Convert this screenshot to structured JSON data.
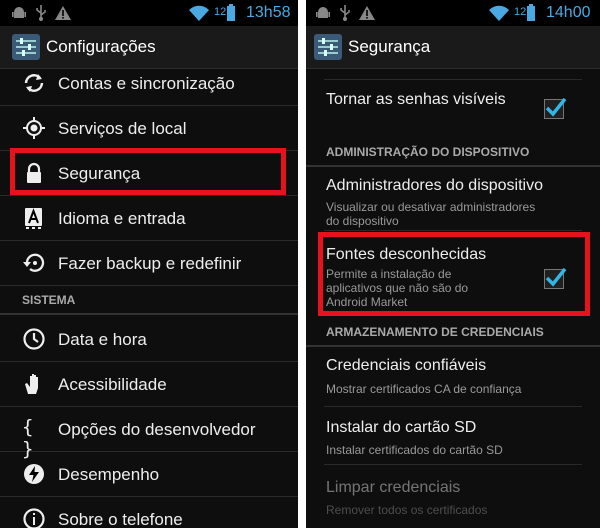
{
  "left": {
    "status": {
      "signal": "12",
      "time": "13h58"
    },
    "title": "Configurações",
    "items": [
      {
        "label": "Contas e sincronização",
        "icon": "sync-icon"
      },
      {
        "label": "Serviços de local",
        "icon": "location-icon"
      },
      {
        "label": "Segurança",
        "icon": "lock-icon"
      },
      {
        "label": "Idioma e entrada",
        "icon": "keyboard-a-icon"
      },
      {
        "label": "Fazer backup e redefinir",
        "icon": "backup-restore-icon"
      }
    ],
    "section": "SISTEMA",
    "system_items": [
      {
        "label": "Data e hora",
        "icon": "clock-icon"
      },
      {
        "label": "Acessibilidade",
        "icon": "hand-icon"
      },
      {
        "label": "Opções do desenvolvedor",
        "icon": "braces-icon"
      },
      {
        "label": "Desempenho",
        "icon": "performance-icon"
      },
      {
        "label": "Sobre o telefone",
        "icon": "info-icon"
      }
    ],
    "developer_glyph": "{ }"
  },
  "right": {
    "status": {
      "signal": "12",
      "time": "14h00"
    },
    "title": "Segurança",
    "show_passwords": {
      "title": "Tornar as senhas visíveis",
      "checked": true
    },
    "section_admin": "ADMINISTRAÇÃO DO DISPOSITIVO",
    "admins": {
      "title": "Administradores do dispositivo",
      "subtitle_1": "Visualizar ou desativar administradores",
      "subtitle_2": "do dispositivo"
    },
    "unknown_sources": {
      "title": "Fontes desconhecidas",
      "subtitle_1": "Permite a instalação de",
      "subtitle_2": "aplicativos que não são do",
      "subtitle_3": "Android Market",
      "checked": true
    },
    "section_credentials": "ARMAZENAMENTO DE CREDENCIAIS",
    "trusted": {
      "title": "Credenciais confiáveis",
      "subtitle": "Mostrar certificados CA de confiança"
    },
    "install_sd": {
      "title": "Instalar do cartão SD",
      "subtitle": "Instalar certificados do cartão SD"
    },
    "clear": {
      "title": "Limpar credenciais",
      "subtitle": "Remover todos os certificados"
    }
  },
  "colors": {
    "highlight": "#e8121e",
    "accent": "#4aa9e2",
    "check": "#33b5e5"
  }
}
